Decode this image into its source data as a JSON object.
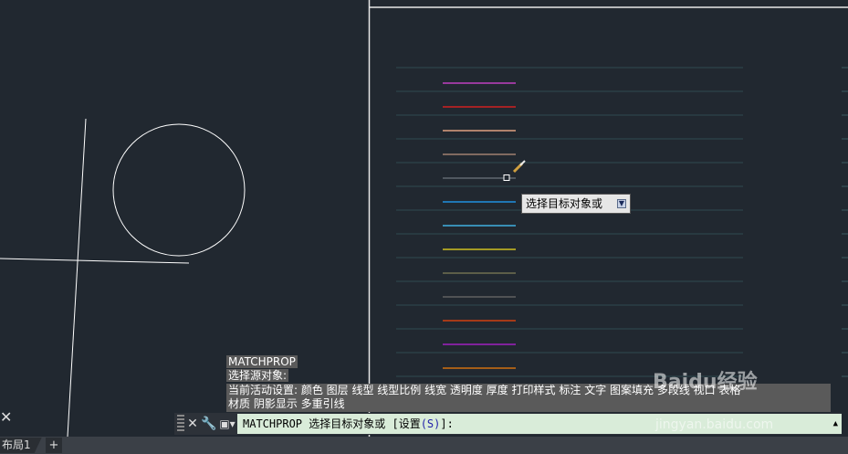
{
  "tooltip": {
    "text": "选择目标对象或"
  },
  "history": {
    "line1": "MATCHPROP",
    "line2": "选择源对象:",
    "line3": "当前活动设置:  颜色 图层 线型 线型比例 线宽 透明度 厚度 打印样式 标注 文字 图案填充 多段线 视口 表格",
    "line4": "材质 阴影显示 多重引线"
  },
  "command": {
    "prompt": "MATCHPROP 选择目标对象或 [设置",
    "option": "(S)",
    "suffix": "]:"
  },
  "tabs": {
    "layout": "布局1",
    "add": "+"
  },
  "watermark": {
    "logo": "Baidu经验",
    "url": "jingyan.baidu.com"
  },
  "colors": {
    "background": "#212830",
    "sample_lines": [
      "#c040c0",
      "#d02020",
      "#e0a080",
      "#a08070",
      "#606870",
      "#2090e0",
      "#40b0e0",
      "#d0c020",
      "#707050",
      "#606060",
      "#d04010",
      "#a020c0",
      "#d07010"
    ]
  }
}
